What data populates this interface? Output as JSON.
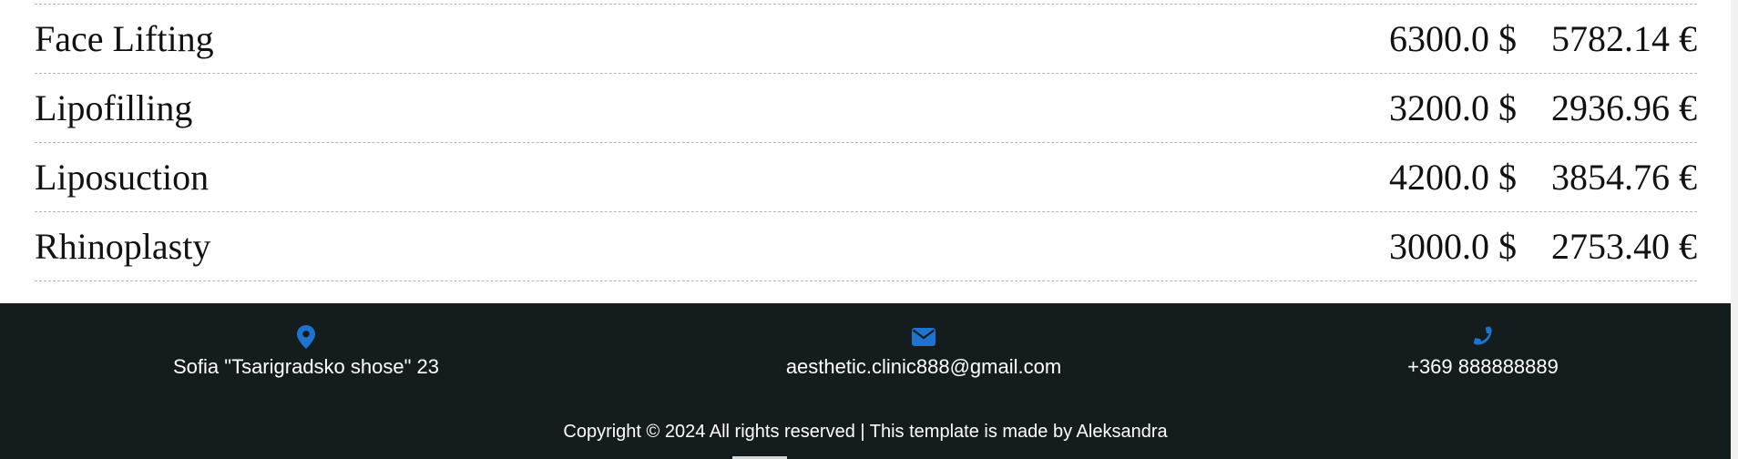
{
  "colors": {
    "footer_bg": "#141c1d",
    "accent_blue": "#1e73d0",
    "divider": "#b5b5b5"
  },
  "price_list": {
    "rows": [
      {
        "service": "Face Lifting",
        "usd": "6300.0 $",
        "eur": "5782.14 €"
      },
      {
        "service": "Lipofilling",
        "usd": "3200.0 $",
        "eur": "2936.96 €"
      },
      {
        "service": "Liposuction",
        "usd": "4200.0 $",
        "eur": "3854.76 €"
      },
      {
        "service": "Rhinoplasty",
        "usd": "3000.0 $",
        "eur": "2753.40 €"
      }
    ]
  },
  "footer": {
    "address": {
      "icon": "location-pin-icon",
      "text": "Sofia \"Tsarigradsko shose\" 23"
    },
    "email": {
      "icon": "envelope-icon",
      "text": "aesthetic.clinic888@gmail.com"
    },
    "phone": {
      "icon": "phone-icon",
      "text": "+369 888888889"
    },
    "copyright": "Copyright © 2024 All rights reserved | This template is made by Aleksandra"
  }
}
